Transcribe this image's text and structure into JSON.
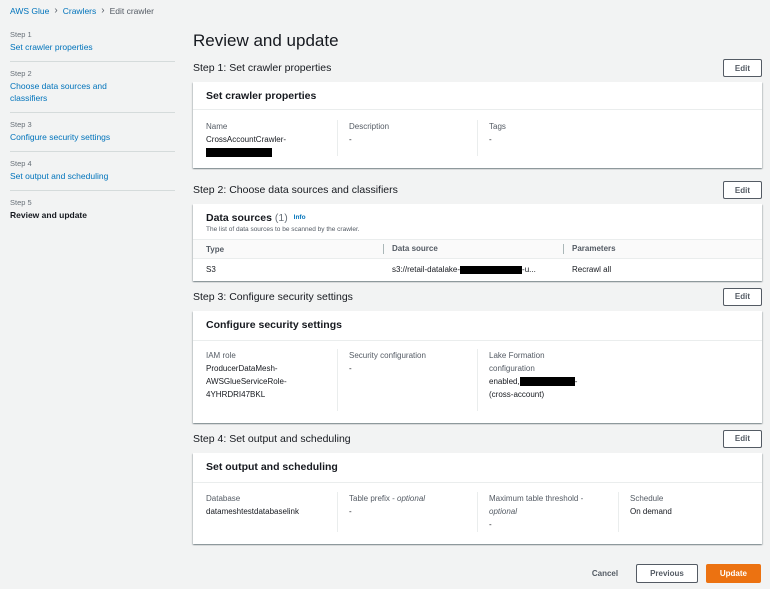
{
  "breadcrumb": {
    "root": "AWS Glue",
    "middle": "Crawlers",
    "current": "Edit crawler"
  },
  "wizard": {
    "steps": [
      {
        "num": "Step 1",
        "label": "Set crawler properties"
      },
      {
        "num": "Step 2",
        "label": "Choose data sources and classifiers"
      },
      {
        "num": "Step 3",
        "label": "Configure security settings"
      },
      {
        "num": "Step 4",
        "label": "Set output and scheduling"
      },
      {
        "num": "Step 5",
        "label": "Review and update"
      }
    ]
  },
  "page_title": "Review and update",
  "edit_label": "Edit",
  "step1": {
    "heading": "Step 1: Set crawler properties",
    "card_title": "Set crawler properties",
    "name_label": "Name",
    "name_value": "CrossAccountCrawler-",
    "desc_label": "Description",
    "desc_value": "-",
    "tags_label": "Tags",
    "tags_value": "-"
  },
  "step2": {
    "heading": "Step 2: Choose data sources and classifiers",
    "title": "Data sources",
    "count": "(1)",
    "info": "Info",
    "description": "The list of data sources to be scanned by the crawler.",
    "columns": [
      "Type",
      "Data source",
      "Parameters"
    ],
    "rows": [
      {
        "type": "S3",
        "source_prefix": "s3://retail-datalake-",
        "source_suffix": "-u...",
        "params": "Recrawl all"
      }
    ]
  },
  "step3": {
    "heading": "Step 3: Configure security settings",
    "card_title": "Configure security settings",
    "iam_label": "IAM role",
    "iam_line1": "ProducerDataMesh-",
    "iam_line2": "AWSGlueServiceRole-",
    "iam_line3": "4YHRDRI47BKL",
    "secconf_label": "Security configuration",
    "secconf_value": "-",
    "lf_label1": "Lake Formation",
    "lf_label2": "configuration",
    "lf_value1": "enabled,",
    "lf_value1_end": "-",
    "lf_value2": "(cross-account)"
  },
  "step4": {
    "heading": "Step 4: Set output and scheduling",
    "card_title": "Set output and scheduling",
    "db_label": "Database",
    "db_value": "datameshtestdatabaselink",
    "prefix_label": "Table prefix - ",
    "prefix_optional": "optional",
    "prefix_value": "-",
    "threshold_label": "Maximum table threshold -",
    "threshold_optional": "optional",
    "threshold_value": "-",
    "schedule_label": "Schedule",
    "schedule_value": "On demand"
  },
  "footer": {
    "cancel": "Cancel",
    "previous": "Previous",
    "update": "Update"
  },
  "colors": {
    "link": "#0073bb",
    "primary": "#ec7211",
    "background": "#f2f3f3"
  }
}
